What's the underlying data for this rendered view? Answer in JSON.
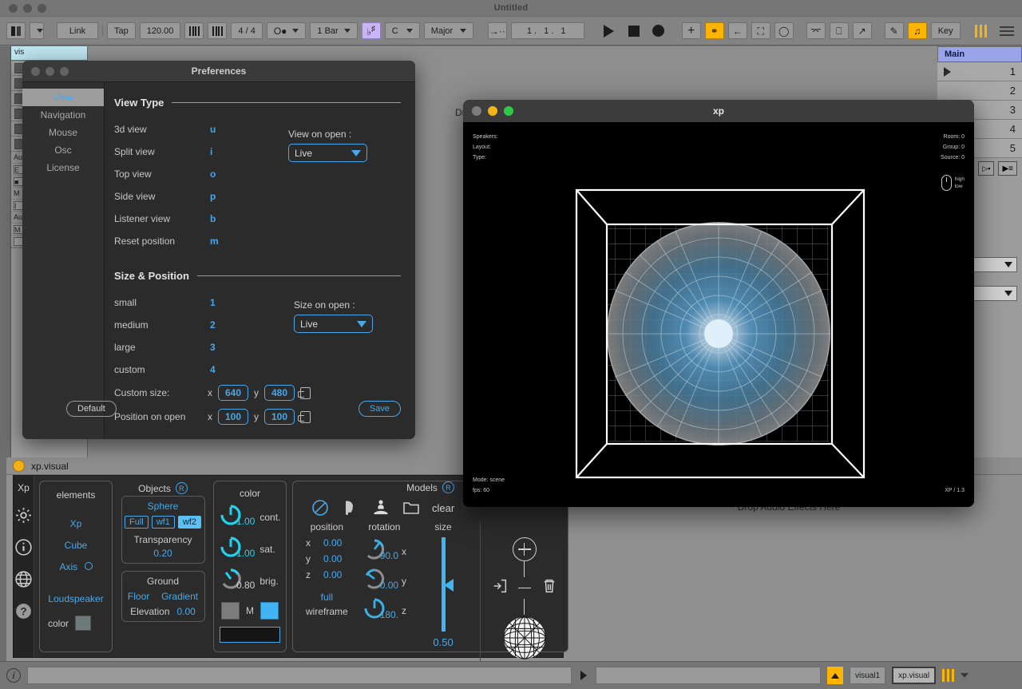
{
  "live": {
    "title": "Untitled",
    "toolbar": {
      "link": "Link",
      "tap": "Tap",
      "tempo": "120.00",
      "time_signature": "4 / 4",
      "quantization": "1 Bar",
      "key": "C",
      "scale": "Major",
      "position": "1. 1. 1",
      "key_map_label": "Key",
      "accent_color": "#ffb400"
    },
    "track": {
      "name": "visual1",
      "name_short": "vis"
    },
    "main_track": {
      "label": "Main",
      "scenes": [
        "1",
        "2",
        "3",
        "4",
        "5"
      ]
    },
    "drop_zone_label": "Drop Audio Effects Here",
    "drop_files_label": "Drop",
    "statusbar": {
      "track_name": "visual1",
      "device_name": "xp.visual"
    }
  },
  "preferences": {
    "title": "Preferences",
    "nav": [
      "View",
      "Navigation",
      "Mouse",
      "Osc",
      "License"
    ],
    "active_nav": "View",
    "view_type": {
      "heading": "View Type",
      "rows": [
        {
          "label": "3d view",
          "key": "u"
        },
        {
          "label": "Split view",
          "key": "i"
        },
        {
          "label": "Top view",
          "key": "o"
        },
        {
          "label": "Side view",
          "key": "p"
        },
        {
          "label": "Listener view",
          "key": "b"
        },
        {
          "label": "Reset position",
          "key": "m"
        }
      ],
      "select_label": "View on open :",
      "select_value": "Live"
    },
    "size_position": {
      "heading": "Size &  Position",
      "rows": [
        {
          "label": "small",
          "key": "1"
        },
        {
          "label": "medium",
          "key": "2"
        },
        {
          "label": "large",
          "key": "3"
        },
        {
          "label": "custom",
          "key": "4"
        }
      ],
      "select_label": "Size on open :",
      "select_value": "Live",
      "custom_size_label": "Custom size:",
      "custom_size_x": "640",
      "custom_size_y": "480",
      "position_label": "Position on open",
      "position_x": "100",
      "position_y": "100",
      "axis_x": "x",
      "axis_y": "y"
    },
    "default_button": "Default",
    "save_button": "Save",
    "accent_color": "#4aa8e8"
  },
  "xp_window": {
    "title": "xp",
    "meta_left": [
      "Speakers:",
      "Layout:",
      "Type:"
    ],
    "meta_right": [
      "Room: 0",
      "Group: 0",
      "Source: 0"
    ],
    "meta_bottom_left": [
      "Mode: scene",
      "fps: 60"
    ],
    "version": "XP / 1.3",
    "mouse_hint_high": "high",
    "mouse_hint_low": "low"
  },
  "device": {
    "title": "xp.visual",
    "rail": {
      "label": "Xp",
      "icons": [
        "gear-icon",
        "info-icon",
        "globe-icon",
        "help-icon"
      ]
    },
    "elements": {
      "title": "elements",
      "items": [
        "Xp",
        "Cube",
        "Axis"
      ],
      "loudspeaker": "Loudspeaker",
      "color_label": "color"
    },
    "objects": {
      "title": "Objects",
      "badge": "R",
      "sphere_title": "Sphere",
      "modes": [
        "Full",
        "wf1",
        "wf2"
      ],
      "active_mode": "wf2",
      "transparency_label": "Transparency",
      "transparency_value": "0.20",
      "ground_title": "Ground",
      "ground_floor": "Floor",
      "ground_gradient": "Gradient",
      "elevation_label": "Elevation",
      "elevation_value": "0.00"
    },
    "color": {
      "title": "color",
      "knobs": [
        {
          "label": "cont.",
          "value": "1.00"
        },
        {
          "label": "sat.",
          "value": "1.00"
        },
        {
          "label": "brig.",
          "value": "0.80"
        }
      ],
      "m_label": "M"
    },
    "models": {
      "title": "Models",
      "badge": "R",
      "clear_label": "clear",
      "position_label": "position",
      "rotation_label": "rotation",
      "size_label": "size",
      "position": [
        {
          "axis": "x",
          "value": "0.00"
        },
        {
          "axis": "y",
          "value": "0.00"
        },
        {
          "axis": "z",
          "value": "0.00"
        }
      ],
      "rotation": [
        {
          "axis": "x",
          "value": "90.0"
        },
        {
          "axis": "y",
          "value": "0.00"
        },
        {
          "axis": "z",
          "value": "180."
        }
      ],
      "size_value": "0.50",
      "render_full": "full",
      "render_wireframe": "wireframe"
    }
  }
}
